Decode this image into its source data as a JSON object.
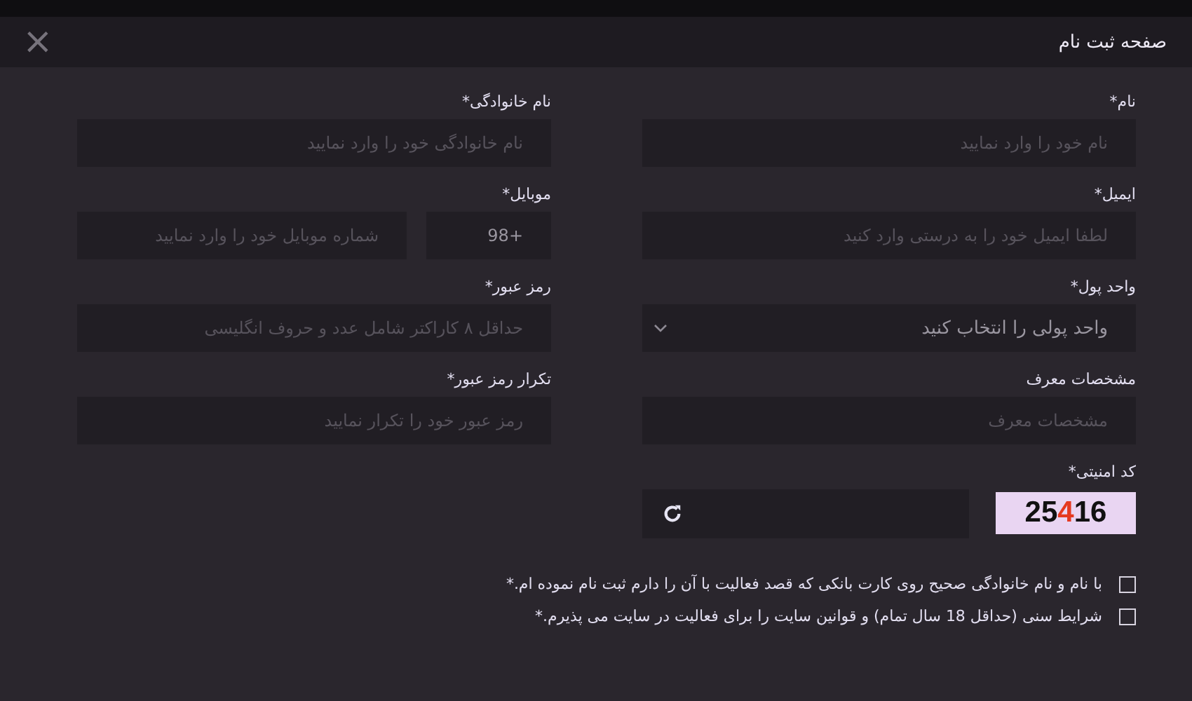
{
  "dialog": {
    "title": "صفحه ثبت نام",
    "close": "×"
  },
  "fields": [
    {
      "kind": "text",
      "label": "نام*",
      "placeholder": "نام خود را وارد نمایید"
    },
    {
      "kind": "text",
      "label": "نام خانوادگی*",
      "placeholder": "نام خانوادگی خود را وارد نمایید"
    },
    {
      "kind": "text",
      "label": "ایمیل*",
      "placeholder": "لطفا ایمیل خود را به درستی وارد کنید"
    },
    {
      "kind": "phone",
      "label": "موبایل*",
      "prefix": "+98",
      "placeholder": "شماره موبایل خود را وارد نمایید"
    },
    {
      "kind": "select",
      "label": "واحد پول*",
      "value": "واحد پولی را انتخاب کنید"
    },
    {
      "kind": "text",
      "label": "رمز عبور*",
      "placeholder": "حداقل ۸ کاراکتر شامل عدد و حروف انگلیسی"
    },
    {
      "kind": "text",
      "label": "مشخصات معرف",
      "placeholder": "مشخصات معرف"
    },
    {
      "kind": "text",
      "label": "تکرار رمز عبور*",
      "placeholder": "رمز عبور خود را تکرار نمایید"
    },
    {
      "kind": "captcha",
      "label": "کد امنیتی*",
      "code": "25416"
    }
  ],
  "agreements": [
    {
      "text": "با نام و نام خانوادگی صحیح روی کارت بانکی که قصد فعالیت با آن را دارم ثبت نام نموده ام.*",
      "checked": false
    },
    {
      "text": "شرایط سنی (حداقل 18 سال تمام) و قوانین سایت را برای فعالیت در سایت می پذیرم.*",
      "checked": false
    }
  ]
}
